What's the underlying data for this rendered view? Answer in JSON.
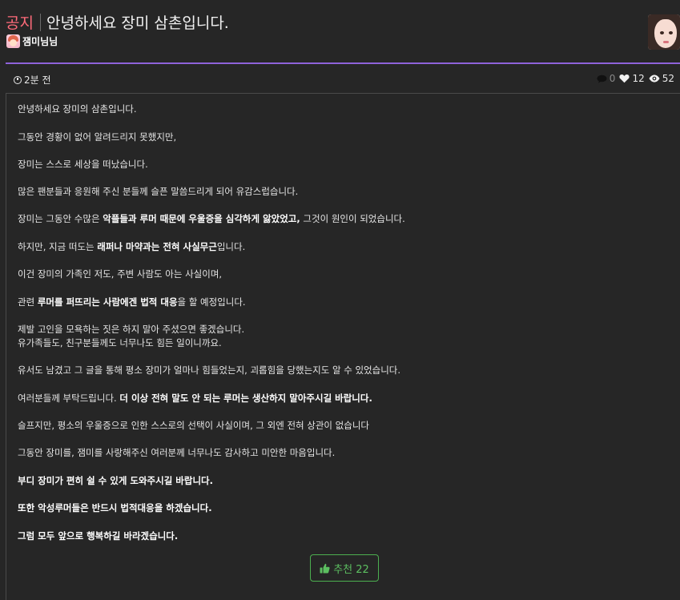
{
  "post": {
    "category": "공지",
    "title": "안녕하세요 장미 삼촌입니다.",
    "author": "잼미님님",
    "time": "2분 전",
    "comments": "0",
    "likes": "12",
    "views": "52"
  },
  "content": {
    "p1": "안녕하세요 장미의 삼촌입니다.",
    "p2": "그동안 경황이 없어 알려드리지 못했지만,",
    "p3": "장미는 스스로 세상을 떠났습니다.",
    "p4": "많은 팬분들과 응원해 주신 분들께 슬픈 말씀드리게 되어 유감스럽습니다.",
    "p5a": "장미는 그동안 수많은 ",
    "p5b": "악플들과 루머 때문에 우울증을 심각하게 앓았었고,",
    "p5c": " 그것이 원인이 되었습니다.",
    "p6a": "하지만, 지금 떠도는 ",
    "p6b": "래퍼나 마약과는 전혀 사실무근",
    "p6c": "입니다.",
    "p7": "이건 장미의 가족인 저도, 주변 사람도 아는 사실이며,",
    "p8a": "관련 ",
    "p8b": "루머를 퍼뜨리는 사람에겐 법적 대응",
    "p8c": "을 할 예정입니다.",
    "p9a": "제발 고인을 모욕하는 짓은 하지 말아 주셨으면 좋겠습니다.",
    "p9b": "유가족들도, 친구분들께도 너무나도 힘든 일이니까요.",
    "p10": "유서도 남겼고 그 글을 통해 평소 장미가 얼마나 힘들었는지, 괴롭힘을 당했는지도 알 수 있었습니다.",
    "p11a": "여러분들께 부탁드립니다. ",
    "p11b": "더 이상 전혀 말도 안 되는 루머는 생산하지 말아주시길 바랍니다.",
    "p12": "슬프지만, 평소의 우울증으로 인한 스스로의 선택이 사실이며, 그 외엔 전혀 상관이 없습니다",
    "p13": "그동안 장미를, 잼미를 사랑해주신 여러분께 너무나도 감사하고 미안한 마음입니다.",
    "p14": "부디 장미가 편히 쉴 수 있게 도와주시길 바랍니다.",
    "p15": "또한 악성루머들은 반드시 법적대응을 하겠습니다.",
    "p16": "그럼 모두 앞으로 행복하길 바라겠습니다."
  },
  "recommend": {
    "label": "추천 22"
  },
  "icons": {
    "author": "author-badge-icon",
    "clock": "clock-icon",
    "comment": "comment-icon",
    "heart": "heart-icon",
    "eye": "eye-icon",
    "thumbs_up": "thumbs-up-icon"
  },
  "colors": {
    "notice": "#ff6b7a",
    "accent_divider": "#8e62d9",
    "recommend": "#5cbf60",
    "background": "#262626"
  }
}
